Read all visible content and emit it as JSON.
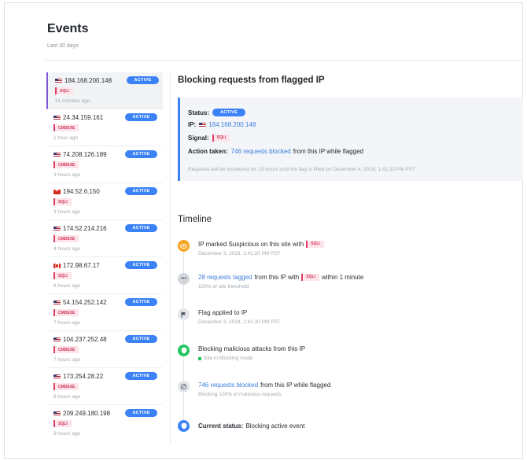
{
  "page": {
    "title": "Events",
    "subtitle": "Last 30 days"
  },
  "events": [
    {
      "ip": "184.168.200.148",
      "country": "us",
      "status": "ACTIVE",
      "signal": "SQLI",
      "time": "31 minutes ago",
      "selected": true
    },
    {
      "ip": "24.34.159.161",
      "country": "us",
      "status": "ACTIVE",
      "signal": "CMDEXE",
      "time": "1 hour ago"
    },
    {
      "ip": "74.208.126.189",
      "country": "us",
      "status": "ACTIVE",
      "signal": "CMDEXE",
      "time": "3 hours ago"
    },
    {
      "ip": "194.52.6.150",
      "country": "ch",
      "status": "ACTIVE",
      "signal": "SQLI",
      "time": "3 hours ago"
    },
    {
      "ip": "174.52.214.216",
      "country": "us",
      "status": "ACTIVE",
      "signal": "CMDEXE",
      "time": "4 hours ago"
    },
    {
      "ip": "172.98.67.17",
      "country": "ca",
      "status": "ACTIVE",
      "signal": "SQLI",
      "time": "6 hours ago"
    },
    {
      "ip": "54.154.252.142",
      "country": "us",
      "status": "ACTIVE",
      "signal": "CMDEXE",
      "time": "7 hours ago"
    },
    {
      "ip": "104.237.252.48",
      "country": "us",
      "status": "ACTIVE",
      "signal": "CMDEXE",
      "time": "7 hours ago"
    },
    {
      "ip": "173.254.28.22",
      "country": "us",
      "status": "ACTIVE",
      "signal": "CMDEXE",
      "time": "8 hours ago"
    },
    {
      "ip": "209.249.180.198",
      "country": "us",
      "status": "ACTIVE",
      "signal": "SQLI",
      "time": "9 hours ago"
    }
  ],
  "detail": {
    "title": "Blocking requests from flagged IP",
    "status_label": "Status:",
    "status_value": "ACTIVE",
    "ip_label": "IP:",
    "ip_value": "184.168.200.148",
    "signal_label": "Signal:",
    "signal_value": "SQLI",
    "action_label": "Action taken:",
    "action_link": "746 requests blocked",
    "action_rest": "from this IP while flagged",
    "monitor_note": "Requests will be monitored for 23 hours until the flag is lifted on December 4, 2018, 1:41:20 PM PST"
  },
  "timeline": {
    "title": "Timeline",
    "items": [
      {
        "icon": "eye-icon",
        "color": "#f5a623",
        "text": "IP marked Suspicious on this site with",
        "signal": "SQLI",
        "sub": "December 3, 2018, 1:41:20 PM PST"
      },
      {
        "icon": "ellipsis-icon",
        "color": "#d3d6db",
        "link": "28 requests tagged",
        "text": "from this IP with",
        "signal": "SQLI",
        "text_after": "within 1 minute",
        "sub": "100% of site threshold"
      },
      {
        "icon": "flag-icon",
        "color": "#e3e5e9",
        "text": "Flag applied to IP",
        "sub": "December 3, 2018, 1:41:30 PM PST"
      },
      {
        "icon": "shield-icon",
        "color": "#22c55e",
        "text": "Blocking malicious attacks from this IP",
        "sub": "Site in Blocking mode"
      },
      {
        "icon": "blocked-icon",
        "color": "#e3e5e9",
        "link": "746 requests blocked",
        "text": "from this IP while flagged",
        "sub": "Blocking 100% of malicious requests"
      },
      {
        "icon": "shield-icon",
        "color": "#3b82f6",
        "label": "Current status:",
        "text": "Blocking active event"
      }
    ]
  },
  "colors": {
    "accent": "#3b82f6",
    "selected_bar": "#7b55d6",
    "signal_red": "#e03a5e"
  }
}
